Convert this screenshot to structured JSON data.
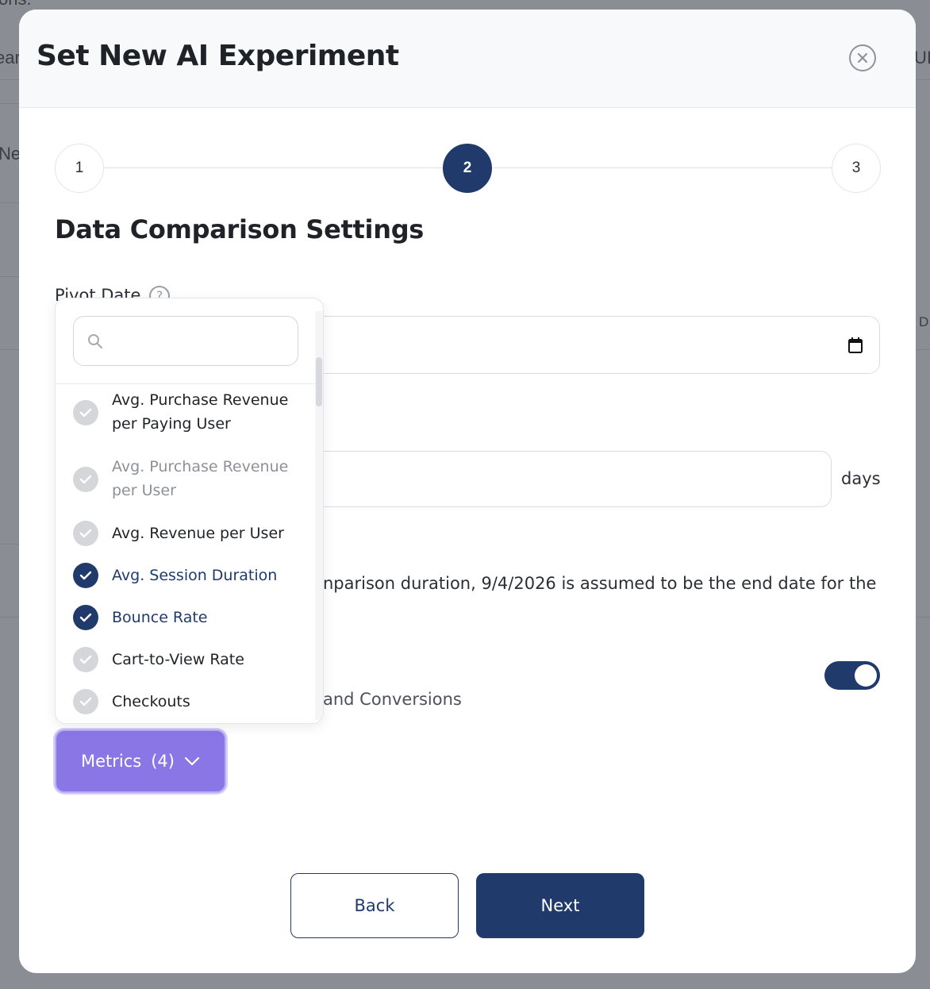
{
  "background": {
    "frag1": "ons.",
    "frag2": "ear",
    "frag3": "Ne",
    "frag4": "UI",
    "frag5": "D"
  },
  "modal": {
    "title": "Set New AI Experiment",
    "close_icon": "close-icon"
  },
  "stepper": {
    "steps": [
      {
        "label": "1",
        "active": false
      },
      {
        "label": "2",
        "active": true
      },
      {
        "label": "3",
        "active": false
      }
    ]
  },
  "section": {
    "title": "Data Comparison Settings",
    "pivot_label": "Pivot Date",
    "help_glyph": "?",
    "days_suffix": "days",
    "info_text": "nparison duration, 9/4/2026 is assumed to be the end date for the",
    "toggle_label": "and Conversions",
    "toggle_on": true
  },
  "metrics_button": {
    "label": "Metrics",
    "count": "(4)"
  },
  "dropdown": {
    "search_placeholder": "",
    "items": [
      {
        "label": "Avg. Purchase Revenue per Paying User",
        "checked": false,
        "dim": false
      },
      {
        "label": "Avg. Purchase Revenue per User",
        "checked": false,
        "dim": true
      },
      {
        "label": "Avg. Revenue per User",
        "checked": false,
        "dim": false
      },
      {
        "label": "Avg. Session Duration",
        "checked": true,
        "dim": false
      },
      {
        "label": "Bounce Rate",
        "checked": true,
        "dim": false
      },
      {
        "label": "Cart-to-View Rate",
        "checked": false,
        "dim": false
      },
      {
        "label": "Checkouts",
        "checked": false,
        "dim": false
      }
    ]
  },
  "footer": {
    "back_label": "Back",
    "next_label": "Next"
  },
  "colors": {
    "primary": "#1f3a6b",
    "accent": "#8a76e5",
    "overlay": "#8a8e94"
  }
}
